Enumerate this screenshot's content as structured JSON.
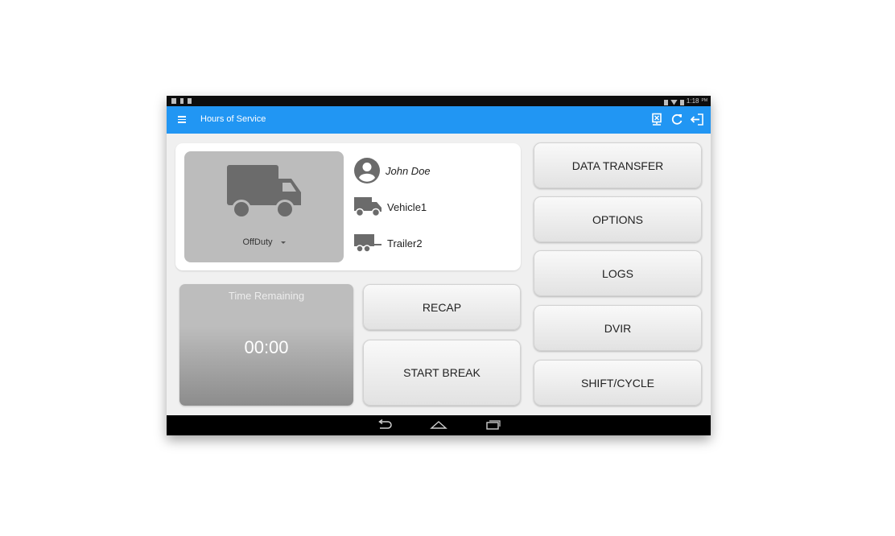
{
  "status_bar": {
    "time": "1:18",
    "ampm": "PM"
  },
  "app_bar": {
    "title": "Hours of Service",
    "color": "#2196f3",
    "icons": [
      "menu-icon",
      "data-transfer-icon",
      "refresh-icon",
      "logout-icon"
    ]
  },
  "driver_card": {
    "duty_status": "OffDuty",
    "driver_name": "John Doe",
    "vehicle": "Vehicle1",
    "trailer": "Trailer2"
  },
  "time_remaining": {
    "label": "Time Remaining",
    "value": "00:00"
  },
  "center_buttons": {
    "recap": "RECAP",
    "start_break": "START BREAK"
  },
  "right_buttons": {
    "data_transfer": "DATA TRANSFER",
    "options": "OPTIONS",
    "logs": "LOGS",
    "dvir": "DVIR",
    "shift_cycle": "SHIFT/CYCLE"
  },
  "nav_bar": {
    "icons": [
      "back-icon",
      "home-icon",
      "recents-icon"
    ]
  }
}
